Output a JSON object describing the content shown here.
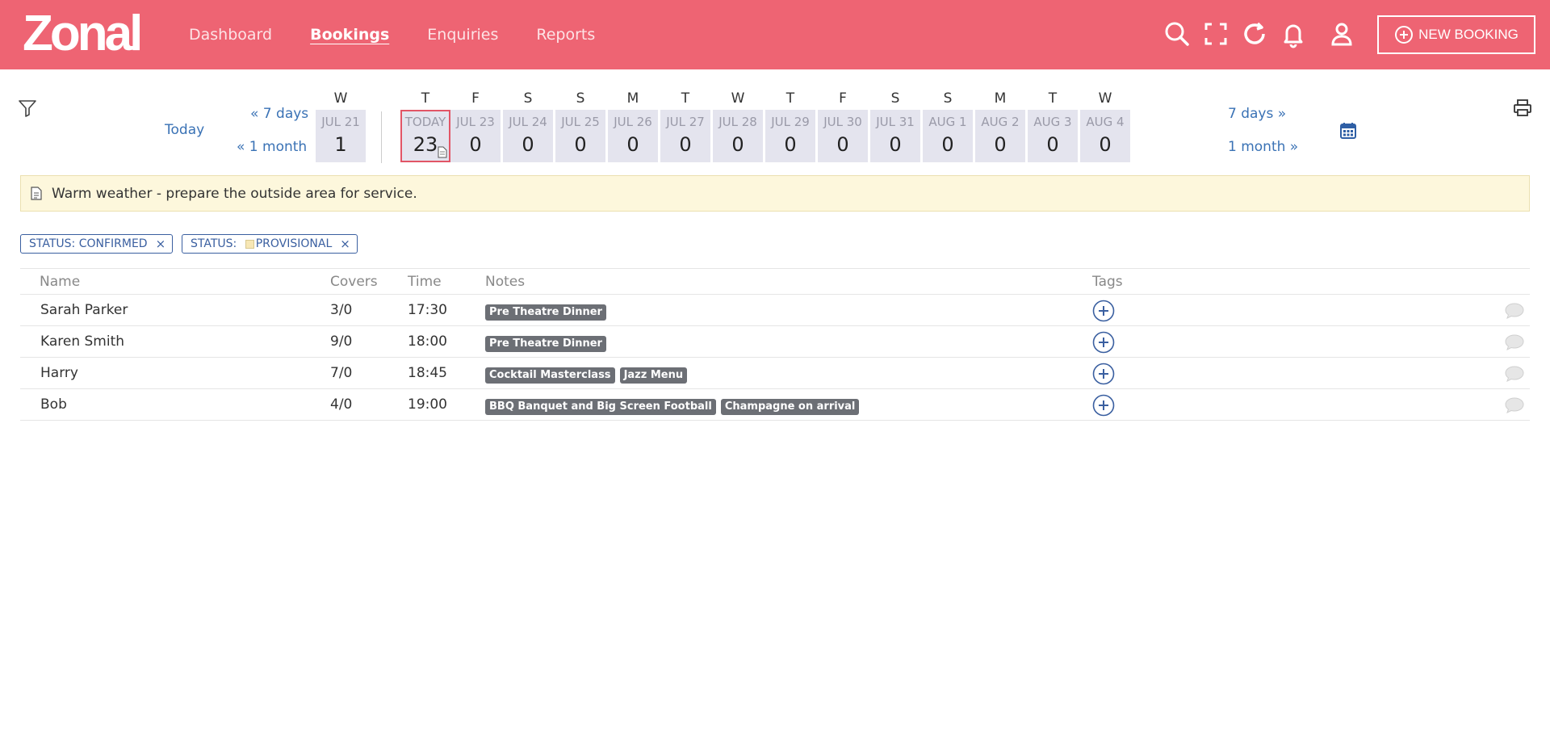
{
  "header": {
    "logo": "Zonal",
    "nav": [
      {
        "label": "Dashboard",
        "active": false
      },
      {
        "label": "Bookings",
        "active": true
      },
      {
        "label": "Enquiries",
        "active": false
      },
      {
        "label": "Reports",
        "active": false
      }
    ],
    "icons": [
      "search-icon",
      "fullscreen-icon",
      "refresh-icon",
      "bell-icon",
      "user-icon"
    ],
    "new_booking_label": "NEW BOOKING"
  },
  "date_nav": {
    "today_link": "Today",
    "back_7": "« 7 days",
    "back_month": "« 1 month",
    "fwd_7": "7 days »",
    "fwd_month": "1 month »",
    "days": [
      {
        "letter": "W",
        "label": "JUL 21",
        "count": "1"
      },
      {
        "letter": "T",
        "label": "TODAY",
        "count": "23",
        "today": true
      },
      {
        "letter": "F",
        "label": "JUL 23",
        "count": "0"
      },
      {
        "letter": "S",
        "label": "JUL 24",
        "count": "0"
      },
      {
        "letter": "S",
        "label": "JUL 25",
        "count": "0"
      },
      {
        "letter": "M",
        "label": "JUL 26",
        "count": "0"
      },
      {
        "letter": "T",
        "label": "JUL 27",
        "count": "0"
      },
      {
        "letter": "W",
        "label": "JUL 28",
        "count": "0"
      },
      {
        "letter": "T",
        "label": "JUL 29",
        "count": "0"
      },
      {
        "letter": "F",
        "label": "JUL 30",
        "count": "0"
      },
      {
        "letter": "S",
        "label": "JUL 31",
        "count": "0"
      },
      {
        "letter": "S",
        "label": "AUG 1",
        "count": "0"
      },
      {
        "letter": "M",
        "label": "AUG 2",
        "count": "0"
      },
      {
        "letter": "T",
        "label": "AUG 3",
        "count": "0"
      },
      {
        "letter": "W",
        "label": "AUG 4",
        "count": "0"
      }
    ]
  },
  "warning": {
    "text": "Warm weather - prepare the outside area for service."
  },
  "filters": {
    "confirmed": "STATUS: CONFIRMED",
    "provisional_prefix": "STATUS: ",
    "provisional_value": "PROVISIONAL",
    "remove": "×"
  },
  "table": {
    "headers": {
      "name": "Name",
      "covers": "Covers",
      "time": "Time",
      "notes": "Notes",
      "tags": "Tags"
    },
    "rows": [
      {
        "name": "Sarah Parker",
        "covers": "3/0",
        "time": "17:30",
        "notes": [
          "Pre Theatre Dinner"
        ]
      },
      {
        "name": "Karen Smith",
        "covers": "9/0",
        "time": "18:00",
        "notes": [
          "Pre Theatre Dinner"
        ]
      },
      {
        "name": "Harry",
        "covers": "7/0",
        "time": "18:45",
        "notes": [
          "Cocktail Masterclass",
          "Jazz Menu"
        ]
      },
      {
        "name": "Bob",
        "covers": "4/0",
        "time": "19:00",
        "notes": [
          "BBQ Banquet and Big Screen Football",
          "Champagne on arrival"
        ]
      }
    ]
  },
  "colors": {
    "header": "#ee6473",
    "link": "#3a72b5",
    "tag": "#6c6f75"
  }
}
